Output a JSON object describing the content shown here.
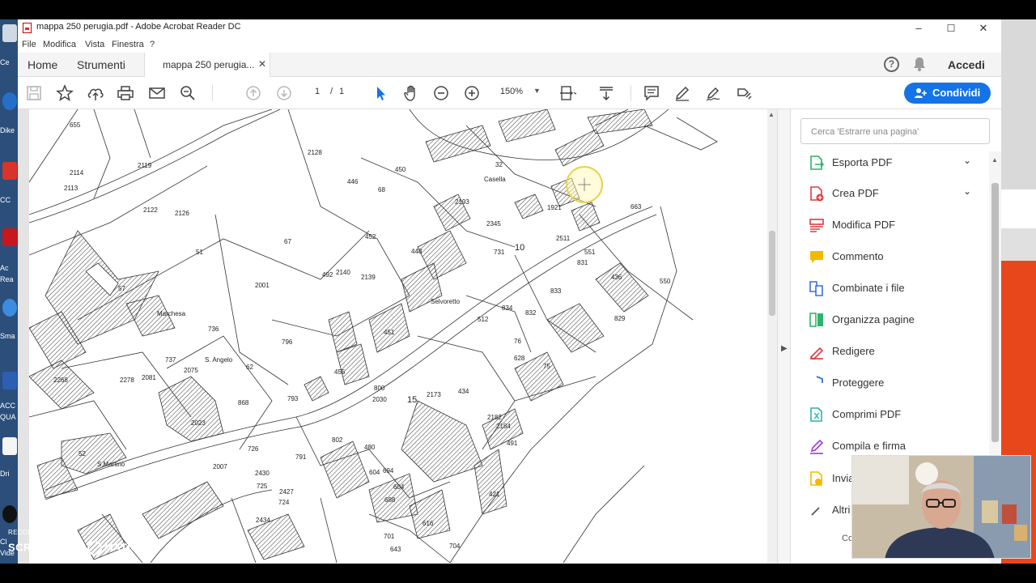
{
  "window": {
    "title": "mappa 250 perugia.pdf - Adobe Acrobat Reader DC",
    "minimize": "–",
    "maximize": "☐",
    "close": "✕"
  },
  "menubar": [
    "File",
    "Modifica",
    "Vista",
    "Finestra",
    "?"
  ],
  "tabs": {
    "home": "Home",
    "tools": "Strumenti",
    "document": "mappa 250 perugia...",
    "document_close": "✕",
    "help": "?",
    "signin": "Accedi"
  },
  "toolbar": {
    "page_current": "1",
    "page_separator": "/",
    "page_total": "1",
    "zoom": "150%",
    "share_label": "Condividi"
  },
  "right_pane": {
    "search_placeholder": "Cerca 'Estrarre una pagina'",
    "tools": [
      {
        "label": "Esporta PDF",
        "icon": "export-pdf-icon",
        "color": "#2db36c"
      },
      {
        "label": "Crea PDF",
        "icon": "create-pdf-icon",
        "color": "#e0393e"
      },
      {
        "label": "Modifica PDF",
        "icon": "edit-pdf-icon",
        "color": "#e0393e"
      },
      {
        "label": "Commento",
        "icon": "comment-icon",
        "color": "#f5b800"
      },
      {
        "label": "Combinate i file",
        "icon": "combine-files-icon",
        "color": "#3b6de0"
      },
      {
        "label": "Organizza pagine",
        "icon": "organize-pages-icon",
        "color": "#2db36c"
      },
      {
        "label": "Redigere",
        "icon": "redact-icon",
        "color": "#e0393e"
      },
      {
        "label": "Proteggere",
        "icon": "protect-icon",
        "color": "#3b6de0"
      },
      {
        "label": "Comprimi PDF",
        "icon": "compress-pdf-icon",
        "color": "#2db3a8"
      },
      {
        "label": "Compila e firma",
        "icon": "fill-sign-icon",
        "color": "#9b3be0"
      },
      {
        "label": "Invia",
        "icon": "send-icon",
        "color": "#f5b800"
      },
      {
        "label": "Altri",
        "icon": "more-tools-icon",
        "color": "#555555"
      }
    ],
    "more_label": "Co"
  },
  "map": {
    "labels": [
      "655",
      "2128",
      "2119",
      "2114",
      "2113",
      "2122",
      "2126",
      "446",
      "68",
      "450",
      "2193",
      "32",
      "Casella",
      "2345",
      "10",
      "731",
      "1921",
      "2511",
      "663",
      "551",
      "831",
      "436",
      "550",
      "452",
      "67",
      "51",
      "57",
      "2001",
      "492",
      "2140",
      "2139",
      "448",
      "Selvoretto",
      "512",
      "834",
      "832",
      "833",
      "829",
      "736",
      "796",
      "62",
      "737",
      "2075",
      "2081",
      "2278",
      "2268",
      "2023",
      "868",
      "726",
      "2430",
      "725",
      "2427",
      "724",
      "2434",
      "52",
      "S.Martino",
      "2007",
      "451",
      "434",
      "76",
      "75",
      "628",
      "800",
      "2030",
      "15",
      "2173",
      "2182",
      "2184",
      "491",
      "802",
      "480",
      "604",
      "694",
      "604",
      "688",
      "421",
      "701",
      "616",
      "704",
      "643",
      "791",
      "793",
      "455",
      "S. Angelo",
      "Marchesa"
    ]
  },
  "overlay": {
    "recorded_with": "RECORDED WITH",
    "brand_left": "SCREENCAST",
    "brand_right": "MATIC"
  },
  "desktop_left": [
    "Ce",
    "Dike",
    "CC",
    "Ac",
    "Rea",
    "Sma",
    "ACC",
    "QUA",
    "Dri",
    "Cl",
    "Vide"
  ]
}
